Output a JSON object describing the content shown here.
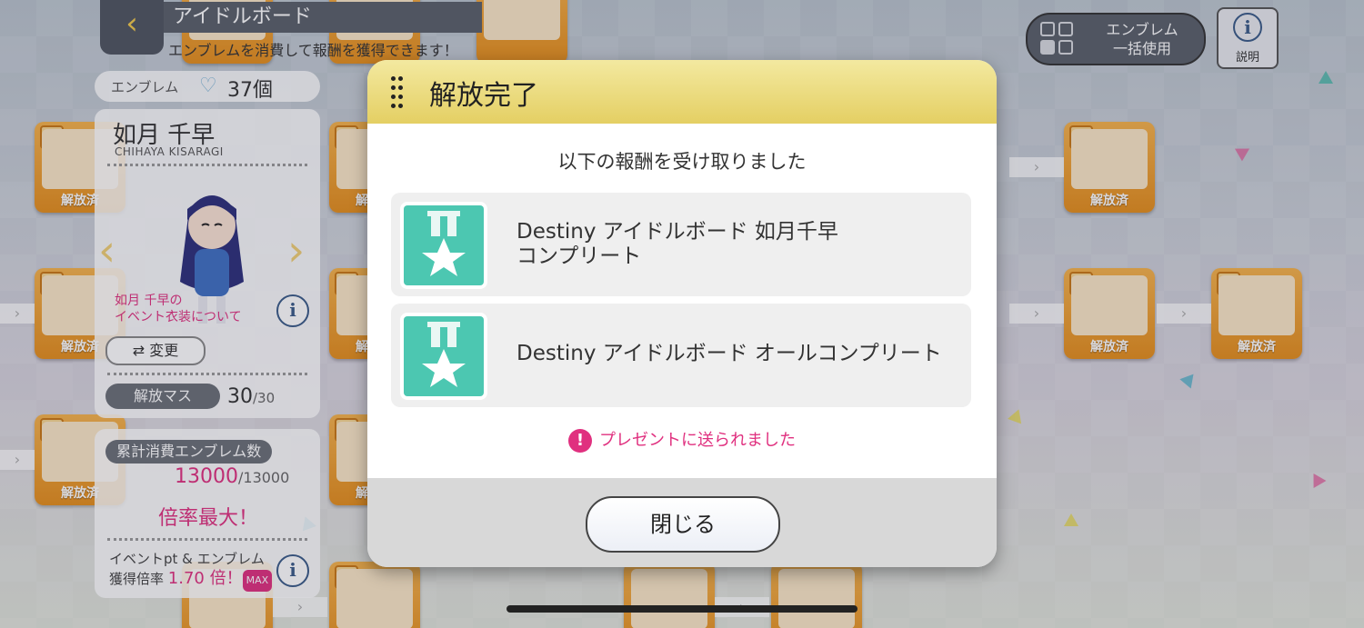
{
  "header": {
    "back_glyph": "‹",
    "title": "アイドルボード",
    "subtitle": "エンブレムを消費して報酬を獲得できます！"
  },
  "left_panel": {
    "emblem_label": "エンブレム",
    "emblem_icon": "heart-emblem-icon",
    "emblem_count": "37個",
    "character_name": "如月 千早",
    "character_roman": "CHIHAYA KISARAGI",
    "costume_note_line1": "如月 千早の",
    "costume_note_line2": "イベント衣装について",
    "info_glyph": "i",
    "change_label": "変更",
    "release_label": "解放マス",
    "release_value": "30",
    "release_total": "/30"
  },
  "cumulative_panel": {
    "title": "累計消費エンブレム数",
    "value": "13000",
    "total": "/13000",
    "max_label": "倍率最大！",
    "rate_line1": "イベントpt & エンブレム",
    "rate_line2": "獲得倍率",
    "rate_value": "1.70 倍！",
    "max_badge": "MAX"
  },
  "top_right": {
    "bulk_line1": "エンブレム",
    "bulk_line2": "一括使用",
    "help_glyph": "i",
    "help_label": "説明"
  },
  "board": {
    "tile_label": "解放済",
    "connector_glyph": "›"
  },
  "modal": {
    "title": "解放完了",
    "message": "以下の報酬を受け取りました",
    "rewards": [
      {
        "line1": "Destiny アイドルボード 如月千早",
        "line2": "コンプリート",
        "icon": "medal-star-icon"
      },
      {
        "line1": "Destiny アイドルボード オールコンプリート",
        "line2": "",
        "icon": "medal-star-icon"
      }
    ],
    "notice_glyph": "!",
    "notice": "プレゼントに送られました",
    "close_label": "閉じる"
  },
  "colors": {
    "accent_pink": "#e0307f",
    "tile_orange": "#f0a235",
    "modal_header": "#e9d877",
    "medal_teal": "#4cc7b1"
  }
}
